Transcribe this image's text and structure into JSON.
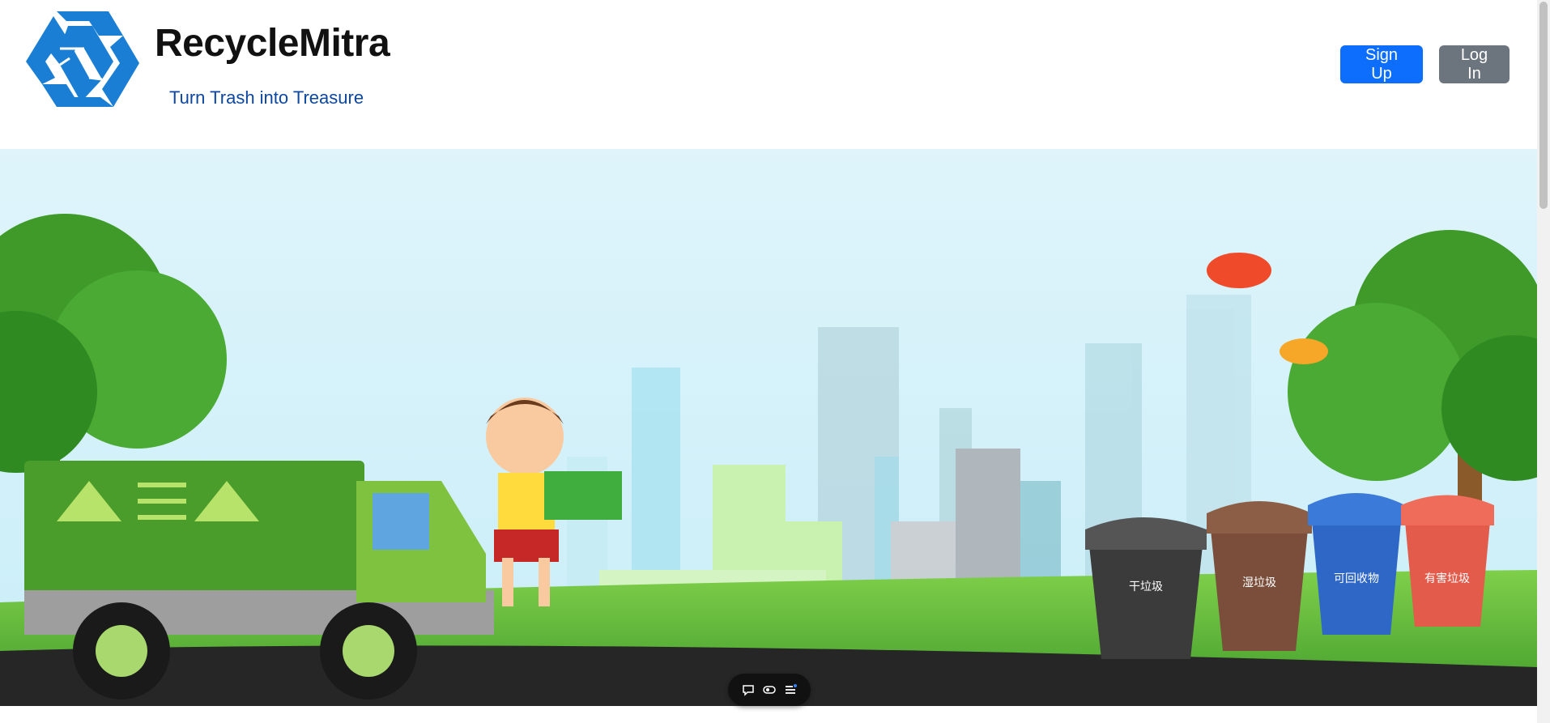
{
  "header": {
    "brand_title": "RecycleMitra",
    "tagline": "Turn Trash into Treasure",
    "signup_label": "Sign Up",
    "login_label": "Log In"
  },
  "hero": {
    "bin_labels": [
      "干垃圾",
      "湿垃圾",
      "可回收物",
      "有害垃圾"
    ]
  },
  "colors": {
    "signup": "#0d6efd",
    "login": "#6c757d",
    "tagline": "#0d47a1",
    "logo": "#1a7fd4"
  },
  "floating_toolbar": {
    "icons": [
      "chat-icon",
      "toggle-icon",
      "menu-icon"
    ]
  }
}
